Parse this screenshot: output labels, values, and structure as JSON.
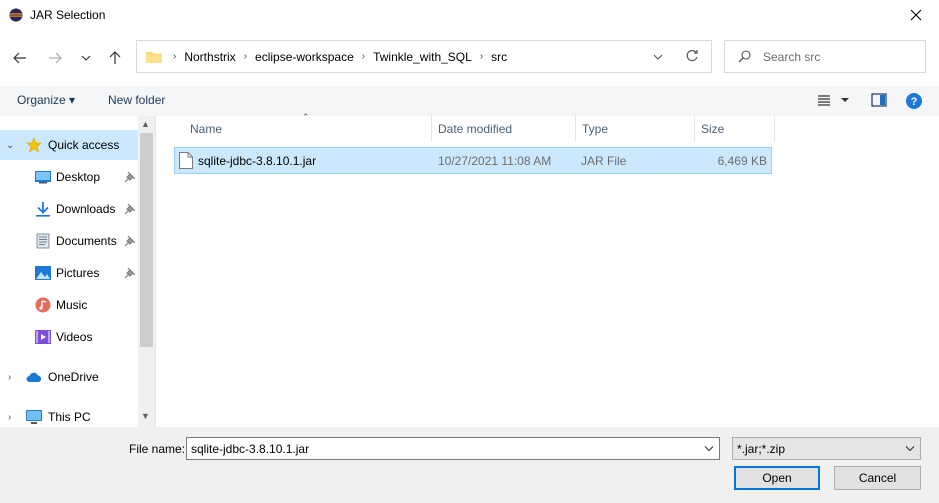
{
  "window": {
    "title": "JAR Selection"
  },
  "address": {
    "crumbs": [
      "Northstrix",
      "eclipse-workspace",
      "Twinkle_with_SQL",
      "src"
    ]
  },
  "search": {
    "placeholder": "Search src"
  },
  "command_bar": {
    "organize_label": "Organize",
    "new_folder_label": "New folder"
  },
  "sidebar": {
    "items": [
      {
        "label": "Quick access",
        "icon": "star-icon",
        "pinned": false
      },
      {
        "label": "Desktop",
        "icon": "desktop-icon",
        "pinned": true
      },
      {
        "label": "Downloads",
        "icon": "download-icon",
        "pinned": true
      },
      {
        "label": "Documents",
        "icon": "documents-icon",
        "pinned": true
      },
      {
        "label": "Pictures",
        "icon": "pictures-icon",
        "pinned": true
      },
      {
        "label": "Music",
        "icon": "music-icon",
        "pinned": false
      },
      {
        "label": "Videos",
        "icon": "videos-icon",
        "pinned": false
      },
      {
        "label": "OneDrive",
        "icon": "cloud-icon",
        "pinned": false
      },
      {
        "label": "This PC",
        "icon": "pc-icon",
        "pinned": false
      }
    ]
  },
  "file_list": {
    "columns": [
      "Name",
      "Date modified",
      "Type",
      "Size"
    ],
    "rows": [
      {
        "name": "sqlite-jdbc-3.8.10.1.jar",
        "date_modified": "10/27/2021 11:08 AM",
        "type": "JAR File",
        "size": "6,469 KB"
      }
    ]
  },
  "bottom": {
    "file_name_label": "File name:",
    "file_name_value": "sqlite-jdbc-3.8.10.1.jar",
    "filter_value": "*.jar;*.zip",
    "open_label": "Open",
    "cancel_label": "Cancel"
  },
  "colors": {
    "accent": "#0078d7",
    "selection": "#cce8ff",
    "folder": "#f8d775"
  }
}
